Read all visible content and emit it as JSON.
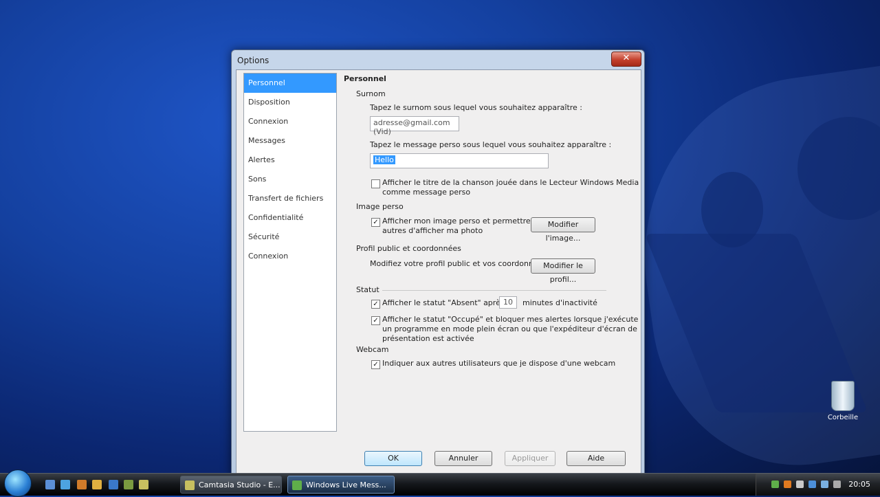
{
  "window": {
    "title": "Options",
    "close": "✕"
  },
  "sidebar": {
    "items": [
      {
        "label": "Personnel"
      },
      {
        "label": "Disposition"
      },
      {
        "label": "Connexion"
      },
      {
        "label": "Messages"
      },
      {
        "label": "Alertes"
      },
      {
        "label": "Sons"
      },
      {
        "label": "Transfert de fichiers"
      },
      {
        "label": "Confidentialité"
      },
      {
        "label": "Sécurité"
      },
      {
        "label": "Connexion"
      }
    ]
  },
  "panel": {
    "heading": "Personnel",
    "surname": {
      "label": "Surnom",
      "prompt": "Tapez le surnom sous lequel vous souhaitez apparaître :",
      "value": "adresse@gmail.com (Vid)",
      "message_prompt": "Tapez le message perso sous lequel vous souhaitez apparaître :",
      "message_value": "Hello",
      "show_title_label": "Afficher le titre de la chanson jouée dans le Lecteur Windows Media",
      "show_title_label2": "comme message perso"
    },
    "image": {
      "label": "Image perso",
      "show_label": "Afficher mon image perso et permettre aux",
      "show_label2": "autres d'afficher ma photo",
      "button": "Modifier l'image..."
    },
    "profile": {
      "label": "Profil public et coordonnées",
      "text": "Modifiez votre profil public et vos coordonnées.",
      "button": "Modifier le profil..."
    },
    "status": {
      "label": "Statut",
      "away_label": "Afficher le statut \"Absent\" après",
      "away_minutes": "10",
      "away_suffix": "minutes d'inactivité",
      "busy_label": "Afficher le statut \"Occupé\" et bloquer mes alertes lorsque j'exécute",
      "busy_label2": "un programme en mode plein écran ou que l'expéditeur d'écran de",
      "busy_label3": "présentation est activée"
    },
    "webcam": {
      "label": "Webcam",
      "share_label": "Indiquer aux autres utilisateurs que je dispose d'une webcam"
    }
  },
  "footer": {
    "ok": "OK",
    "cancel": "Annuler",
    "apply": "Appliquer",
    "help": "Aide"
  },
  "desktop": {
    "recycle_label": "Corbeille"
  },
  "taskbar": {
    "tasks": [
      {
        "label": "Camtasia Studio - E..."
      },
      {
        "label": "Windows Live Mess..."
      }
    ],
    "clock": "20:05"
  }
}
